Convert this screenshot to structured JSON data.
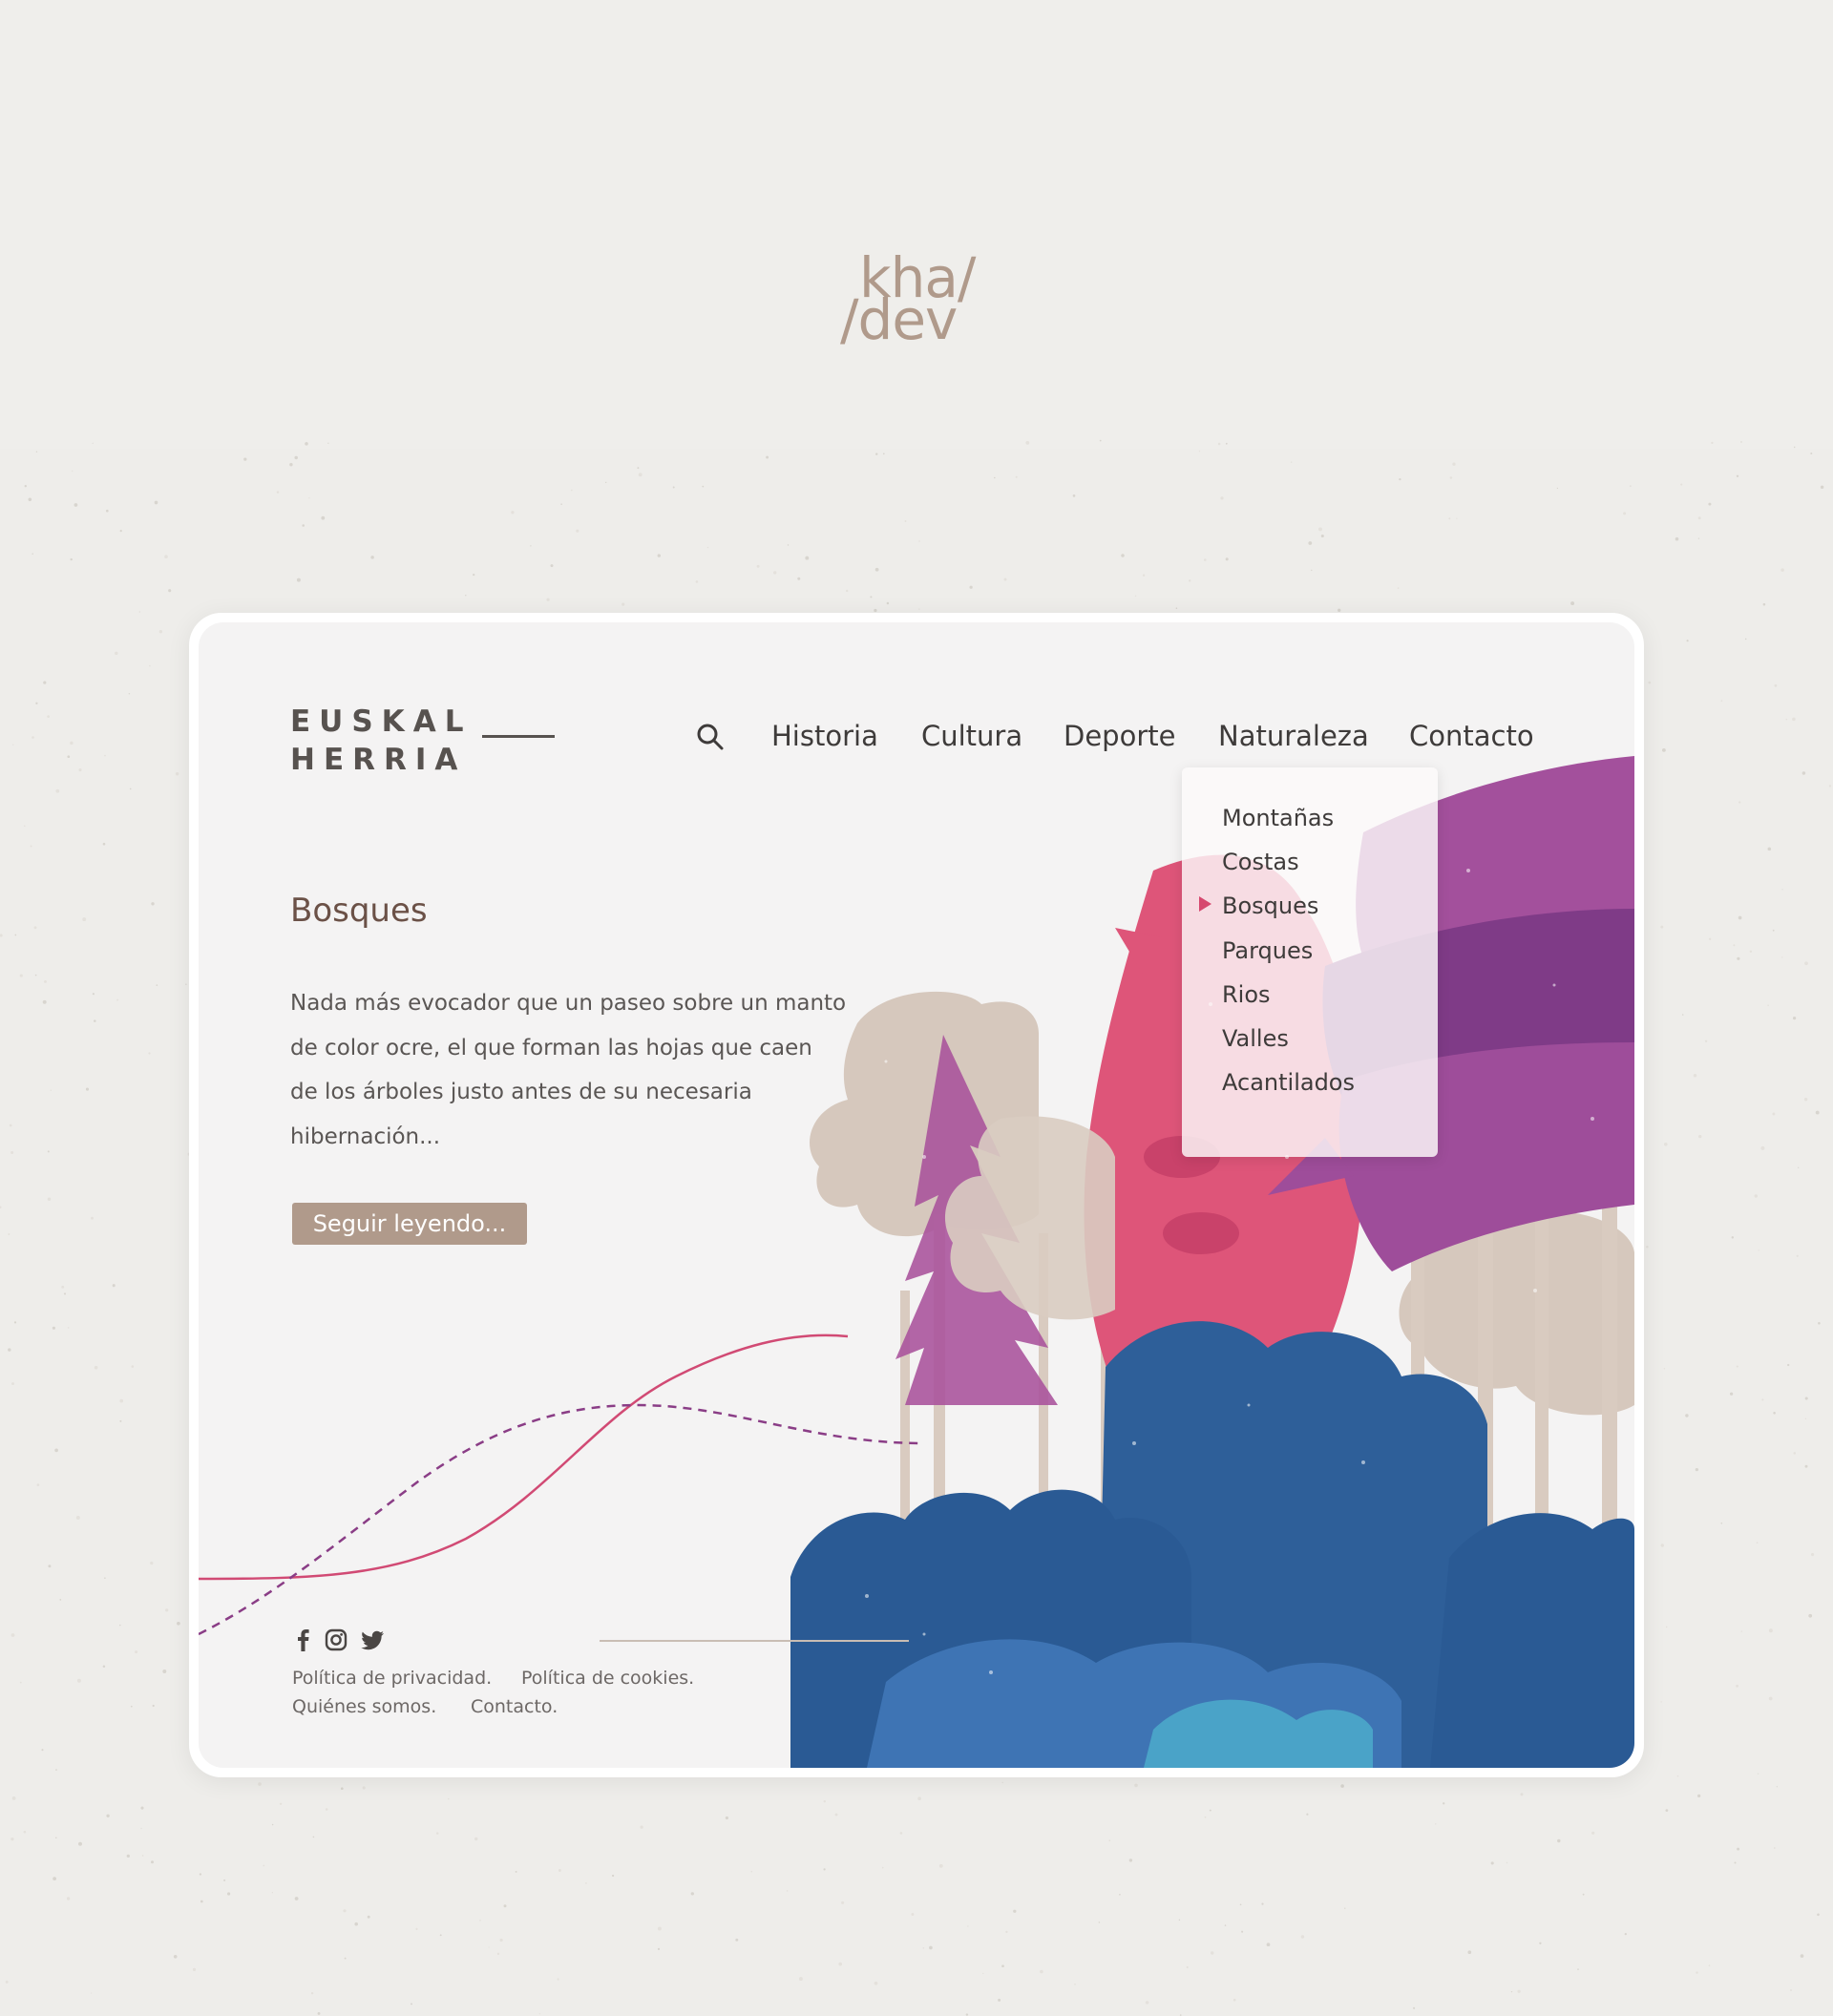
{
  "brand": {
    "line1": "kha/",
    "line2": "/dev"
  },
  "site": {
    "logo_line1": "EUSKAL",
    "logo_line2": "HERRIA",
    "search_icon": "search-icon",
    "nav": [
      "Historia",
      "Cultura",
      "Deporte",
      "Naturaleza",
      "Contacto"
    ],
    "dropdown": {
      "items": [
        "Montañas",
        "Costas",
        "Bosques",
        "Parques",
        "Rios",
        "Valles",
        "Acantilados"
      ],
      "selected": "Bosques",
      "marker_color": "#d6486e"
    }
  },
  "article": {
    "title": "Bosques",
    "lines": [
      "Nada más evocador que un paseo sobre un manto",
      "de color ocre, el que forman las hojas que caen",
      "de los árboles justo antes de su necesaria",
      "hibernación..."
    ],
    "cta": "Seguir leyendo..."
  },
  "footer": {
    "social_icons": [
      "facebook-icon",
      "instagram-icon",
      "twitter-icon"
    ],
    "links": [
      "Política de privacidad.",
      "Política de cookies.",
      "Quiénes somos.",
      "Contacto."
    ]
  },
  "colors": {
    "page_bg": "#eeedea",
    "brand": "#b09a8b",
    "accent_pink": "#d6486e",
    "purple": "#9b4a98",
    "blue": "#2a5a94",
    "beige": "#d6c8bd",
    "button": "#b09a8b"
  }
}
